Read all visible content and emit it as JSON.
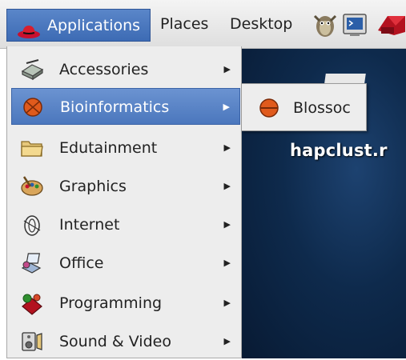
{
  "panel": {
    "applications_label": "Applications",
    "places_label": "Places",
    "desktop_label": "Desktop",
    "launchers": [
      "gnome-gimp-icon",
      "terminal-icon",
      "redhat-icon"
    ]
  },
  "menu": {
    "items": [
      {
        "label": "Accessories",
        "icon": "accessories-icon",
        "arrow": "▶"
      },
      {
        "label": "Bioinformatics",
        "icon": "bioinformatics-icon",
        "arrow": "▶"
      },
      {
        "label": "Edutainment",
        "icon": "folder-icon",
        "arrow": "▶"
      },
      {
        "label": "Graphics",
        "icon": "graphics-icon",
        "arrow": "▶"
      },
      {
        "label": "Internet",
        "icon": "internet-icon",
        "arrow": "▶"
      },
      {
        "label": "Office",
        "icon": "office-icon",
        "arrow": "▶"
      },
      {
        "label": "Programming",
        "icon": "programming-icon",
        "arrow": "▶"
      },
      {
        "label": "Sound & Video",
        "icon": "sound-video-icon",
        "arrow": "▶"
      }
    ]
  },
  "submenu": {
    "items": [
      {
        "label": "Blossoc",
        "icon": "blossoc-icon"
      }
    ]
  },
  "desktop": {
    "file_label": "hapclust.r"
  },
  "colors": {
    "selection": "#4b77bd",
    "menu_bg": "#ededed",
    "desktop_bg": "#0e2a4c"
  }
}
